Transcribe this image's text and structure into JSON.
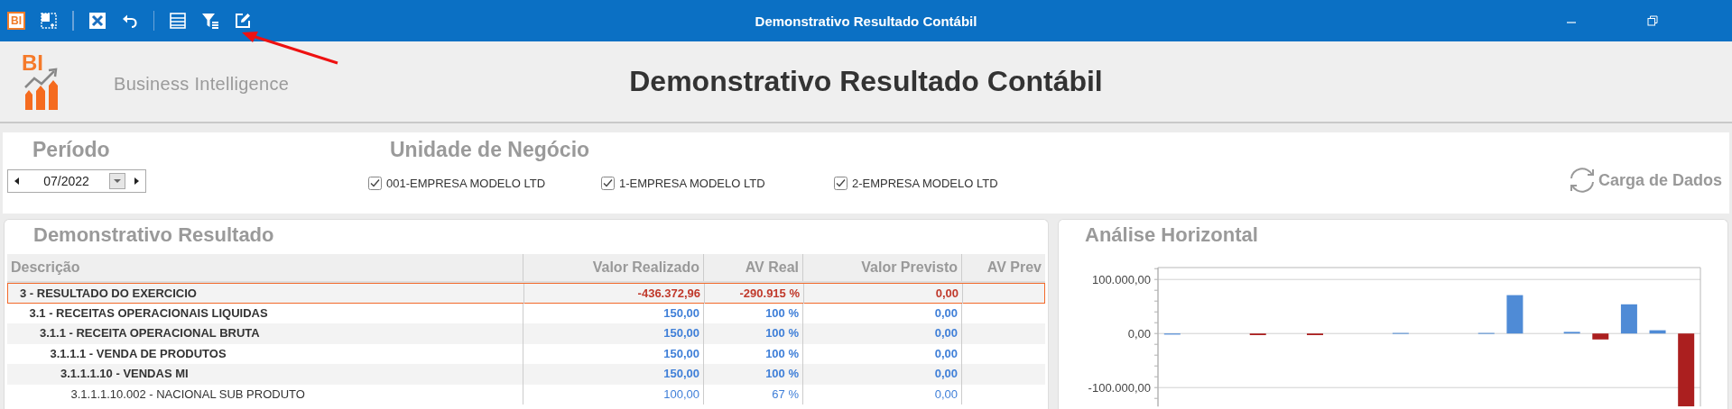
{
  "window": {
    "title": "Demonstrativo Resultado Contábil",
    "toolbar": [
      {
        "kind": "bi",
        "label": "BI"
      },
      {
        "kind": "resize"
      },
      {
        "kind": "separator"
      },
      {
        "kind": "close"
      },
      {
        "kind": "undo"
      },
      {
        "kind": "separator"
      },
      {
        "kind": "list"
      },
      {
        "kind": "filter"
      },
      {
        "kind": "edit"
      }
    ],
    "controls": [
      {
        "kind": "minimize"
      },
      {
        "kind": "restore"
      }
    ]
  },
  "header": {
    "logo_text": "BI",
    "subtitle": "Business Intelligence",
    "title": "Demonstrativo Resultado Contábil"
  },
  "filters": {
    "period": {
      "label": "Período",
      "value": "07/2022"
    },
    "business_units": {
      "label": "Unidade de Negócio",
      "items": [
        {
          "label": "001-EMPRESA MODELO LTD",
          "checked": true
        },
        {
          "label": "1-EMPRESA MODELO LTD",
          "checked": true
        },
        {
          "label": "2-EMPRESA MODELO LTD",
          "checked": true
        }
      ]
    },
    "reload_button": "Carga de Dados"
  },
  "statement": {
    "title": "Demonstrativo Resultado",
    "columns": [
      "Descrição",
      "Valor Realizado",
      "AV Real",
      "Valor Previsto",
      "AV Prev"
    ],
    "rows": [
      {
        "description": "3 - RESULTADO DO EXERCICIO",
        "valor_realizado": "-436.372,96",
        "av_real": "-290.915 %",
        "valor_previsto": "0,00",
        "color": "#c0392b",
        "selected": true,
        "children": [
          {
            "description": "3.1 - RECEITAS OPERACIONAIS LIQUIDAS",
            "valor_realizado": "150,00",
            "av_real": "100 %",
            "valor_previsto": "0,00",
            "color": "#3f7fd8",
            "selected": false,
            "children": [
              {
                "description": "3.1.1 - RECEITA OPERACIONAL BRUTA",
                "valor_realizado": "150,00",
                "av_real": "100 %",
                "valor_previsto": "0,00",
                "color": "#3f7fd8",
                "selected": false,
                "children": [
                  {
                    "description": "3.1.1.1 - VENDA DE PRODUTOS",
                    "valor_realizado": "150,00",
                    "av_real": "100 %",
                    "valor_previsto": "0,00",
                    "color": "#3f7fd8",
                    "selected": false,
                    "children": [
                      {
                        "description": "3.1.1.1.10 - VENDAS MI",
                        "valor_realizado": "150,00",
                        "av_real": "100 %",
                        "valor_previsto": "0,00",
                        "color": "#3f7fd8",
                        "selected": false,
                        "children": [
                          {
                            "description": "3.1.1.1.10.002 - NACIONAL SUB PRODUTO",
                            "valor_realizado": "100,00",
                            "av_real": "67 %",
                            "valor_previsto": "0,00",
                            "color": "#3f7fd8",
                            "selected": false
                          }
                        ]
                      }
                    ]
                  }
                ]
              }
            ]
          }
        ]
      }
    ]
  },
  "chart_panel": {
    "title": "Análise Horizontal",
    "chart_data": {
      "type": "bar",
      "grid": true,
      "ylim": [
        -135000,
        122000
      ],
      "yticks": [
        {
          "value": 100000,
          "label": "100.000,00"
        },
        {
          "value": 0,
          "label": "0,00"
        },
        {
          "value": -100000,
          "label": "-100.000,00"
        }
      ],
      "series": [
        {
          "color": "#4f8bd6",
          "values": [
            -2000,
            null,
            null,
            null,
            null,
            null,
            null,
            null,
            1000,
            null,
            null,
            1000,
            71000,
            null,
            3000,
            null,
            54000,
            6000,
            null
          ]
        },
        {
          "color": "#ab1f1f",
          "values": [
            null,
            null,
            null,
            -3000,
            null,
            -3000,
            null,
            null,
            null,
            null,
            null,
            null,
            null,
            null,
            null,
            -11000,
            null,
            null,
            -135000
          ]
        }
      ]
    }
  }
}
